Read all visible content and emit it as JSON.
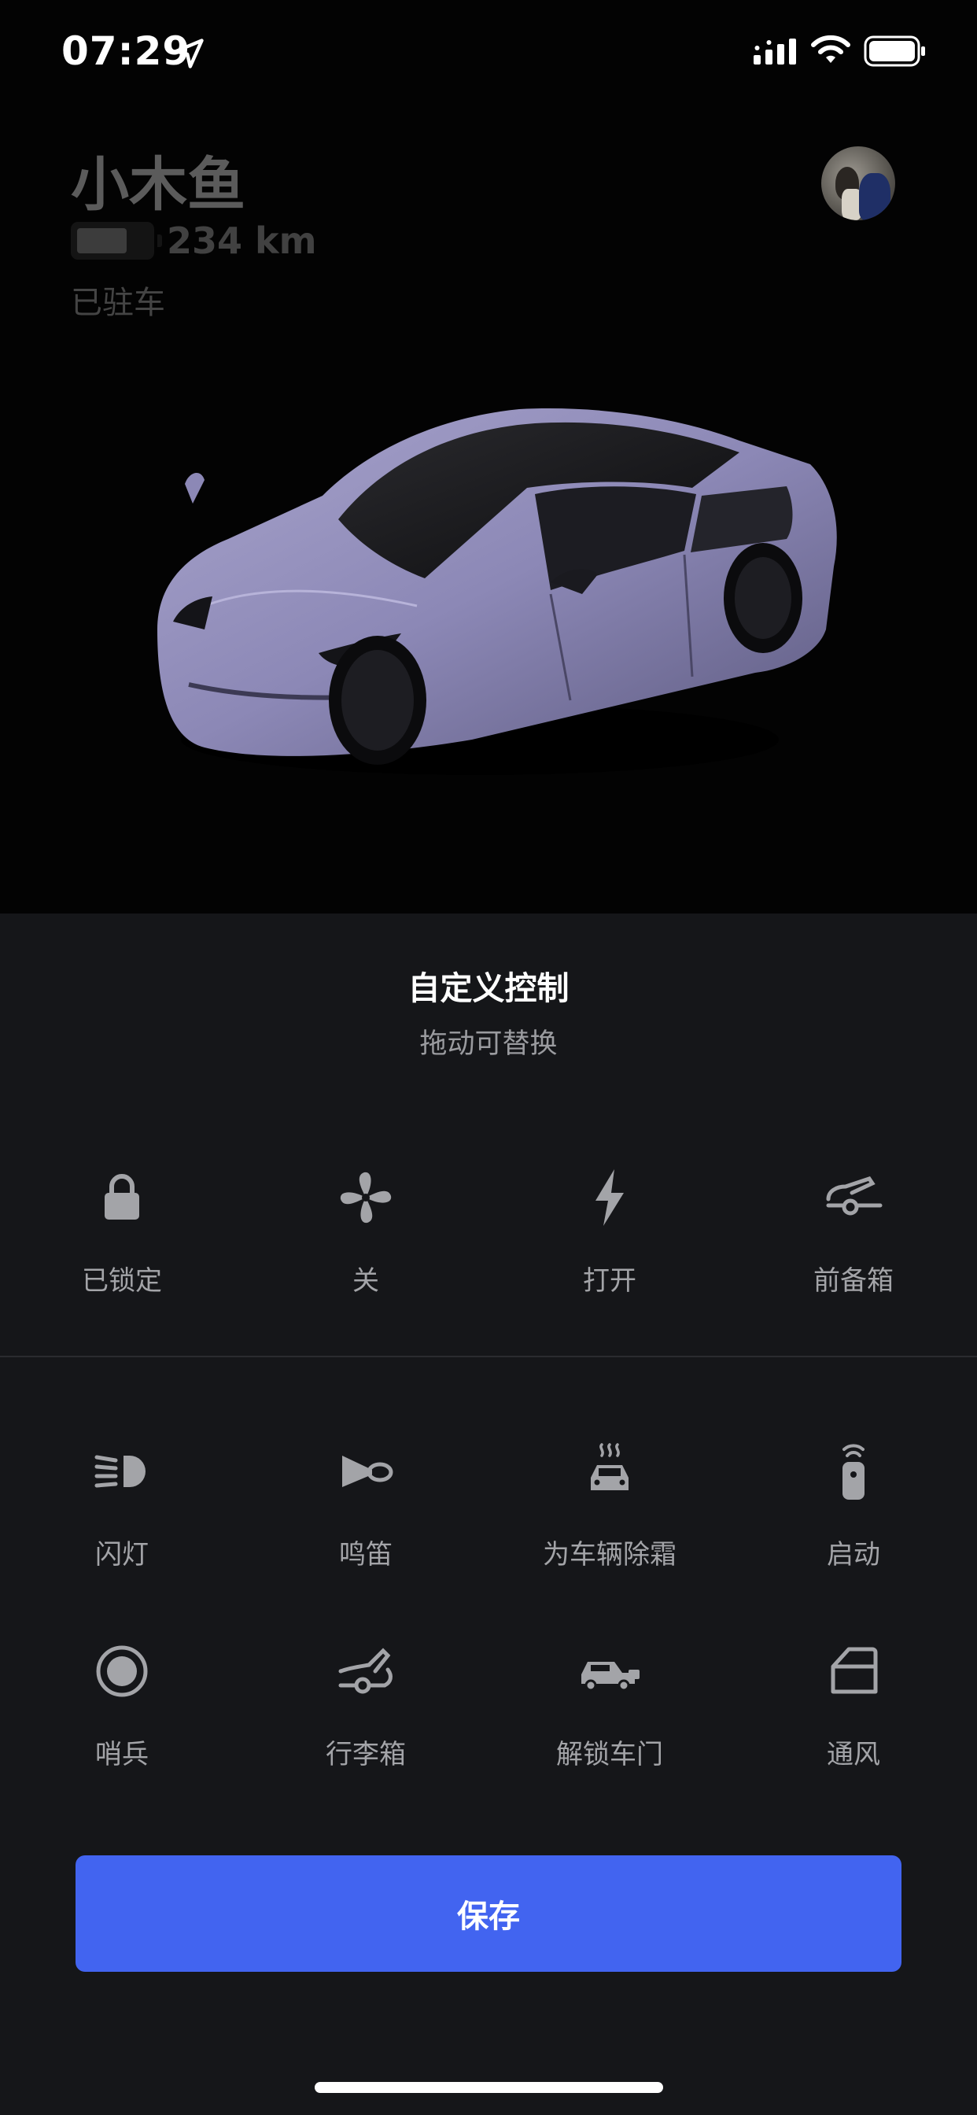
{
  "status_bar": {
    "time": "07:29"
  },
  "vehicle": {
    "name": "小木鱼",
    "range": "234 km",
    "status": "已驻车",
    "battery_level": 0.7,
    "paint_color": "#8c88b6"
  },
  "panel": {
    "title": "自定义控制",
    "subtitle": "拖动可替换"
  },
  "active_controls": [
    {
      "label": "已锁定",
      "icon": "lock-icon"
    },
    {
      "label": "关",
      "icon": "fan-icon"
    },
    {
      "label": "打开",
      "icon": "bolt-icon"
    },
    {
      "label": "前备箱",
      "icon": "frunk-icon"
    }
  ],
  "available_controls": [
    {
      "label": "闪灯",
      "icon": "headlight-icon"
    },
    {
      "label": "鸣笛",
      "icon": "horn-icon"
    },
    {
      "label": "为车辆除霜",
      "icon": "defrost-icon"
    },
    {
      "label": "启动",
      "icon": "key-fob-icon"
    },
    {
      "label": "哨兵",
      "icon": "sentry-icon"
    },
    {
      "label": "行李箱",
      "icon": "trunk-icon"
    },
    {
      "label": "解锁车门",
      "icon": "car-unlock-icon"
    },
    {
      "label": "通风",
      "icon": "window-vent-icon"
    }
  ],
  "save_label": "保存",
  "colors": {
    "accent": "#4264f0",
    "panel_background": "#151619",
    "icon": "#a3a4a8"
  }
}
